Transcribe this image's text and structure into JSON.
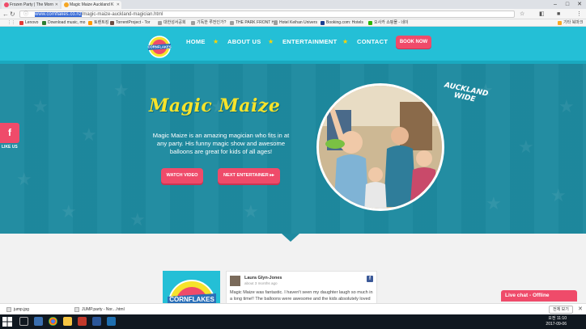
{
  "browser": {
    "tabs": [
      {
        "title": "Frozen Party | The Morn",
        "active": false
      },
      {
        "title": "Magic Maize Auckland K",
        "active": true
      }
    ],
    "url_prefix": "www.cornflakes.co.nz",
    "url_rest": "/magic-maize-auckland-magician.html",
    "bookmarks": [
      "Lenovo",
      "Download music, mo",
      "토렌트킹",
      "TorrentProject - Tor",
      "대한성서공회",
      "기독한 루전인가?",
      "THE PARK FRONT HO",
      "Hotel Keihan Univers",
      "Booking.com: Hotels",
      "오사카 쇼핑몰 - 네이",
      "기타 북마크"
    ]
  },
  "site": {
    "nav": [
      "HOME",
      "ABOUT US",
      "ENTERTAINMENT",
      "CONTACT"
    ],
    "book_now": "BOOK NOW",
    "logo_text": "CORNFLAKES",
    "colors": {
      "header": "#24bfd6",
      "hero": "#1e8aa0",
      "accent": "#ef4b6a",
      "title": "#f6e32b"
    }
  },
  "hero": {
    "title": "Magic Maize",
    "description": "Magic Maize is an amazing magician who fits in at any party. His funny magic show and awesome balloons are great for kids of all ages!",
    "watch_video": "WATCH VIDEO",
    "next_entertainer": "NEXT ENTERTAINER ▸▸",
    "badge_line1": "AUCKLAND",
    "badge_line2": "WIDE"
  },
  "side": {
    "fb_icon": "f",
    "like_us": "LIKE US"
  },
  "review": {
    "name": "Laura Glyn-Jones",
    "time": "about 3 months ago",
    "text": "Magic Maize was fantastic. I haven't seen my daughter laugh so much in a long time!! The balloons were awesome and the kids absolutely loved it!",
    "logo_text": "CORNFLAKES"
  },
  "live_chat": "Live chat - Offline",
  "downloads": {
    "items": [
      "jump.jpg",
      "JUMP.party - Nor....html"
    ],
    "show_all": "전체 보기"
  },
  "taskbar": {
    "time": "오전 11:10",
    "date": "2017-09-06"
  }
}
